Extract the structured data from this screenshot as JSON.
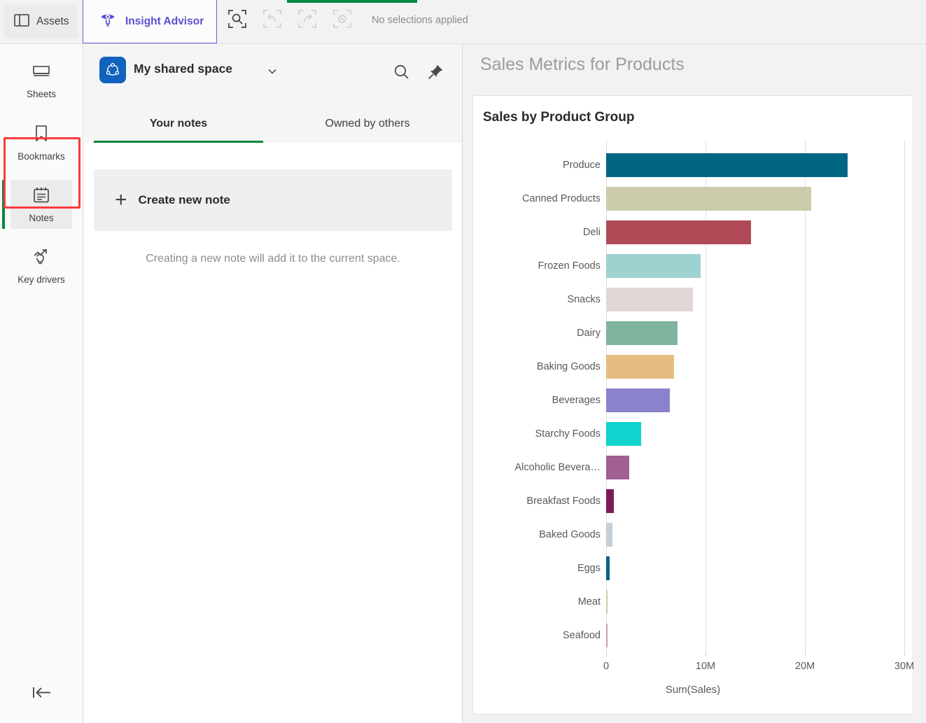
{
  "topbar": {
    "assets_label": "Assets",
    "assets_icon": "panel-layout-icon",
    "insight_advisor_label": "Insight Advisor",
    "insight_advisor_icon": "eye-lightbulb-icon",
    "insight_advisor_color": "#5b4fd1",
    "accent_green": "#00873d",
    "selection_tools": [
      {
        "name": "selections-search-icon",
        "enabled": true
      },
      {
        "name": "selections-undo-icon",
        "enabled": false
      },
      {
        "name": "selections-redo-icon",
        "enabled": false
      },
      {
        "name": "selections-clear-all-icon",
        "enabled": false
      }
    ],
    "no_selections_label": "No selections applied"
  },
  "rail": {
    "items": [
      {
        "label": "Sheets",
        "icon": "sheets-icon",
        "active": false
      },
      {
        "label": "Bookmarks",
        "icon": "bookmark-icon",
        "active": false
      },
      {
        "label": "Notes",
        "icon": "notes-calendar-icon",
        "active": true
      },
      {
        "label": "Key drivers",
        "icon": "key-drivers-lightbulb-icon",
        "active": false
      }
    ],
    "collapse_icon": "collapse-left-icon",
    "highlight_color": "#fd3b3b",
    "active_accent": "#00873d"
  },
  "notes": {
    "space_name": "My shared space",
    "space_icon": "shared-space-icon",
    "space_icon_color": "#1263bd",
    "caret_icon": "chevron-down-icon",
    "search_icon": "search-icon",
    "pin_icon": "pin-icon",
    "tabs": [
      {
        "label": "Your notes",
        "active": true
      },
      {
        "label": "Owned by others",
        "active": false
      }
    ],
    "create_note_label": "Create new note",
    "create_note_icon": "plus-icon",
    "hint": "Creating a new note will add it to the current space."
  },
  "right_panel": {
    "sheet_title": "Sales Metrics for Products"
  },
  "chart_data": {
    "type": "bar",
    "orientation": "horizontal",
    "title": "Sales by Product Group",
    "xlabel": "Sum(Sales)",
    "ylabel": "",
    "xlim": [
      0,
      30000000
    ],
    "xticks": [
      0,
      10000000,
      20000000,
      30000000
    ],
    "xtick_labels": [
      "0",
      "10M",
      "20M",
      "30M"
    ],
    "grid": true,
    "legend": "none",
    "categories": [
      "Produce",
      "Canned Products",
      "Deli",
      "Frozen Foods",
      "Snacks",
      "Dairy",
      "Baking Goods",
      "Beverages",
      "Starchy Foods",
      "Alcoholic Bevera…",
      "Breakfast Foods",
      "Baked Goods",
      "Eggs",
      "Meat",
      "Seafood"
    ],
    "values": [
      24300000,
      20600000,
      14600000,
      9500000,
      8700000,
      7200000,
      6800000,
      6400000,
      3500000,
      2300000,
      800000,
      600000,
      350000,
      150000,
      70000
    ],
    "colors": [
      "#006580",
      "#cccbab",
      "#b04a57",
      "#9dd2d0",
      "#e0d8d5",
      "#80b49d",
      "#e5bd82",
      "#8a83cc",
      "#0fd4ce",
      "#a15f92",
      "#7d1b55",
      "#c5cfd8",
      "#006580",
      "#cccbab",
      "#d79ca5"
    ]
  }
}
